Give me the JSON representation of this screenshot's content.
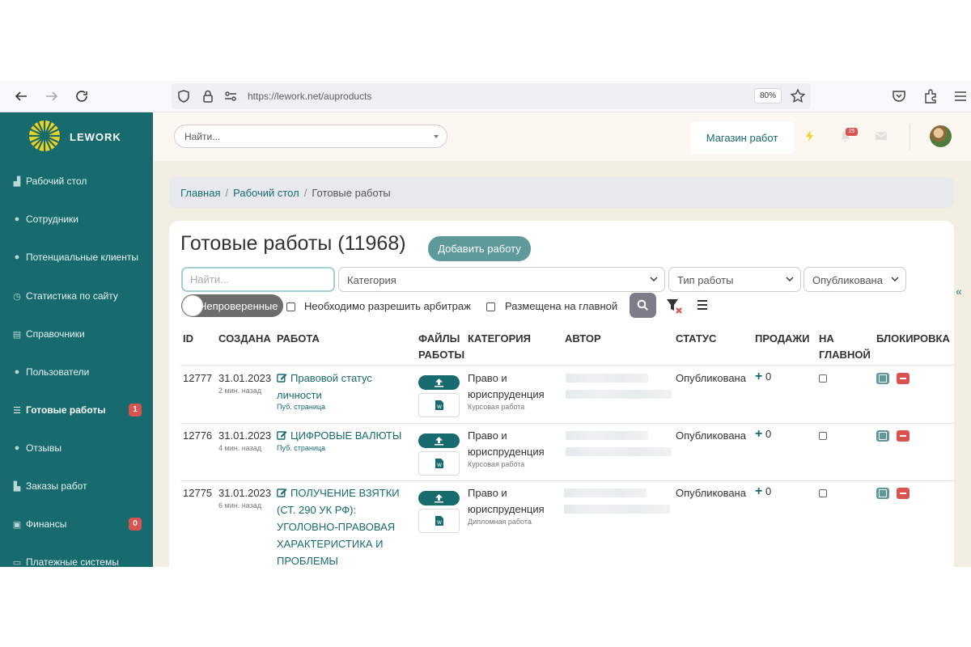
{
  "browser": {
    "url": "https://lework.net/auproducts",
    "zoom": "80%"
  },
  "sidebar": {
    "brand": "LEWORK",
    "items": [
      {
        "label": "Рабочий стол",
        "icon": "dashboard-icon"
      },
      {
        "label": "Сотрудники",
        "icon": "users-icon"
      },
      {
        "label": "Потенциальные клиенты",
        "icon": "user-icon"
      },
      {
        "label": "Статистика по сайту",
        "icon": "clock-icon"
      },
      {
        "label": "Справочники",
        "icon": "book-icon"
      },
      {
        "label": "Пользователи",
        "icon": "users-icon"
      },
      {
        "label": "Готовые работы",
        "icon": "list-icon",
        "badge": "1",
        "active": true
      },
      {
        "label": "Отзывы",
        "icon": "user-lock-icon"
      },
      {
        "label": "Заказы работ",
        "icon": "briefcase-icon"
      },
      {
        "label": "Финансы",
        "icon": "money-icon",
        "badge": "0"
      },
      {
        "label": "Платежные системы",
        "icon": "card-icon"
      }
    ]
  },
  "topbar": {
    "search_placeholder": "Найти...",
    "store_label": "Магазин работ",
    "notifications_count": "25"
  },
  "breadcrumb": {
    "home": "Главная",
    "desk": "Рабочий стол",
    "current": "Готовые работы"
  },
  "page": {
    "title": "Готовые работы",
    "count": "(11968)",
    "add_button": "Добавить работу"
  },
  "filters": {
    "search_placeholder": "Найти...",
    "category": "Категория",
    "work_type": "Тип работы",
    "status": "Опубликована",
    "toggle_label": "Непроверенные",
    "arbitration_label": "Необходимо разрешить арбитраж",
    "on_main_label": "Размещена на главной"
  },
  "table": {
    "headers": {
      "id": "ID",
      "created": "СОЗДАНА",
      "work": "РАБОТА",
      "files_1": "ФАЙЛЫ",
      "files_2": "РАБОТЫ",
      "category": "КАТЕГОРИЯ",
      "author": "АВТОР",
      "status": "СТАТУС",
      "sales": "ПРОДАЖИ",
      "main_1": "НА",
      "main_2": "ГЛАВНОЙ",
      "block": "БЛОКИРОВКА"
    },
    "rows": [
      {
        "id": "12777",
        "date": "31.01.2023",
        "ago": "2 мин. назад",
        "title_lines": [
          "Правовой статус",
          "личности"
        ],
        "pub_link": "Пуб. страница",
        "category_lines": [
          "Право и",
          "юриспруденция"
        ],
        "work_type": "Курсовая работа",
        "status": "Опубликована",
        "sales": "0"
      },
      {
        "id": "12776",
        "date": "31.01.2023",
        "ago": "4 мин. назад",
        "title_lines": [
          "ЦИФРОВЫЕ ВАЛЮТЫ"
        ],
        "pub_link": "Пуб. страница",
        "category_lines": [
          "Право и",
          "юриспруденция"
        ],
        "work_type": "Курсовая работа",
        "status": "Опубликована",
        "sales": "0"
      },
      {
        "id": "12775",
        "date": "31.01.2023",
        "ago": "6 мин. назад",
        "title_lines": [
          "ПОЛУЧЕНИЕ ВЗЯТКИ",
          "(СТ. 290 УК РФ):",
          "УГОЛОВНО-ПРАВОВАЯ",
          "ХАРАКТЕРИСТИКА И",
          "ПРОБЛЕМЫ"
        ],
        "pub_link": "",
        "category_lines": [
          "Право и",
          "юриспруденция"
        ],
        "work_type": "Дипломная работа",
        "status": "Опубликована",
        "sales": "0"
      }
    ]
  }
}
